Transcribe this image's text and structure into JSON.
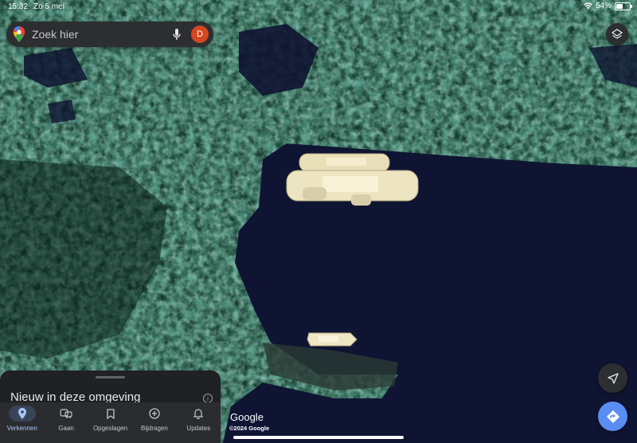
{
  "status_bar": {
    "time": "15:32",
    "date": "Zo 5 mei",
    "battery_text": "54%",
    "battery_level": 0.54
  },
  "search": {
    "placeholder": "Zoek hier",
    "avatar_initial": "D"
  },
  "bottom_sheet": {
    "title": "Nieuw in deze omgeving",
    "nav": [
      {
        "label": "Verkennen",
        "icon": "location-pin-icon",
        "active": true
      },
      {
        "label": "Gaan",
        "icon": "commute-icon",
        "active": false
      },
      {
        "label": "Opgeslagen",
        "icon": "bookmark-icon",
        "active": false
      },
      {
        "label": "Bijdragen",
        "icon": "add-circle-icon",
        "active": false
      },
      {
        "label": "Updates",
        "icon": "bell-icon",
        "active": false
      }
    ]
  },
  "map": {
    "attribution_logo": "Google",
    "copyright": "©2024 Google"
  },
  "colors": {
    "water": "#11163a",
    "vegetation": "#2c5a45",
    "accent": "#5b8cf2",
    "avatar": "#d4481f"
  }
}
